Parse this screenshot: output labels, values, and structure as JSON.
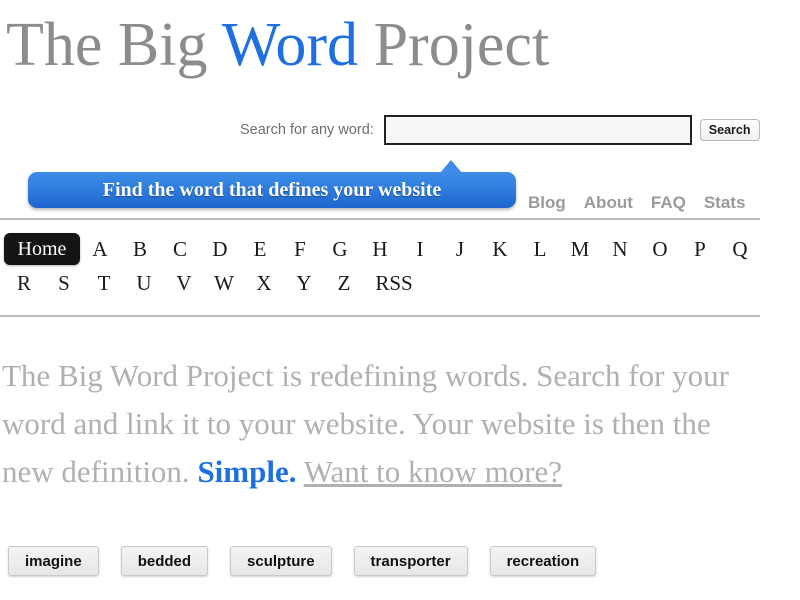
{
  "header": {
    "title_part1": "The Big ",
    "title_accent": "Word",
    "title_part2": " Project",
    "accent_color": "#1f6fe0",
    "title_color": "#8c8c8c"
  },
  "search": {
    "label": "Search for any word:",
    "value": "",
    "placeholder": "",
    "button_label": "Search"
  },
  "callout": {
    "text": "Find the word that defines your website",
    "color": "#2f7ddd"
  },
  "top_nav": {
    "items": [
      {
        "label": "Blog"
      },
      {
        "label": "About"
      },
      {
        "label": "FAQ"
      },
      {
        "label": "Stats"
      }
    ]
  },
  "alpha_nav": {
    "home_label": "Home",
    "row1": [
      "A",
      "B",
      "C",
      "D",
      "E",
      "F",
      "G",
      "H",
      "I",
      "J",
      "K",
      "L",
      "M",
      "N",
      "O",
      "P",
      "Q"
    ],
    "row2": [
      "R",
      "S",
      "T",
      "U",
      "V",
      "W",
      "X",
      "Y",
      "Z"
    ],
    "rss_label": "RSS"
  },
  "intro": {
    "text_before": "The Big Word Project is redefining words. Search for your word and link it to your website. Your website is then the new definition. ",
    "link_simple": "Simple.",
    "spacer": " ",
    "link_more": "Want to know more?"
  },
  "word_buttons": {
    "items": [
      {
        "label": "imagine"
      },
      {
        "label": "bedded"
      },
      {
        "label": "sculpture"
      },
      {
        "label": "transporter"
      },
      {
        "label": "recreation"
      }
    ]
  }
}
